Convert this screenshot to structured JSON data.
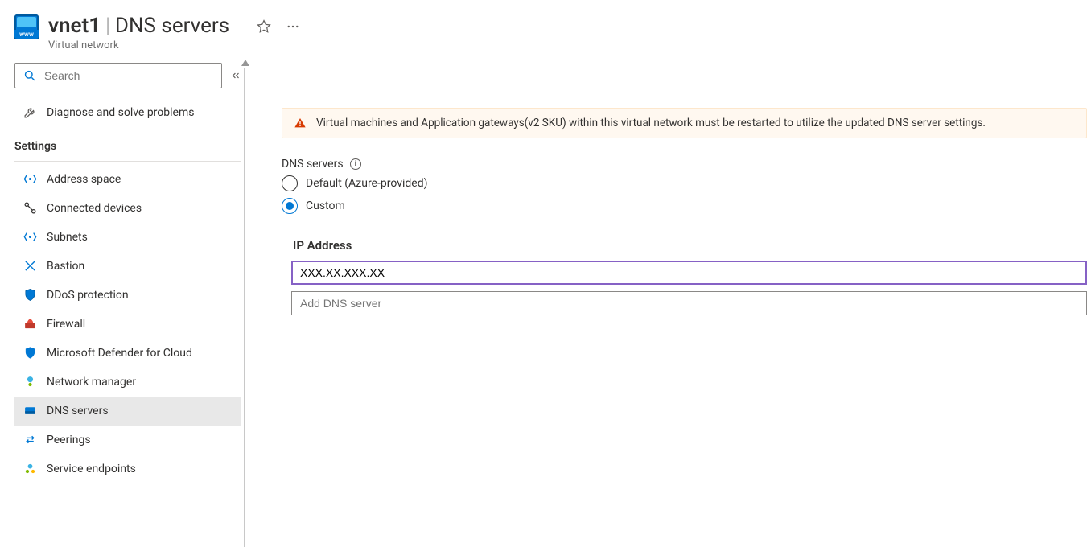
{
  "header": {
    "resource_name": "vnet1",
    "page_title": "DNS servers",
    "resource_type": "Virtual network"
  },
  "sidebar": {
    "search_placeholder": "Search",
    "top_item": {
      "label": "Diagnose and solve problems"
    },
    "section_label": "Settings",
    "items": [
      {
        "label": "Address space",
        "selected": false
      },
      {
        "label": "Connected devices",
        "selected": false
      },
      {
        "label": "Subnets",
        "selected": false
      },
      {
        "label": "Bastion",
        "selected": false
      },
      {
        "label": "DDoS protection",
        "selected": false
      },
      {
        "label": "Firewall",
        "selected": false
      },
      {
        "label": "Microsoft Defender for Cloud",
        "selected": false
      },
      {
        "label": "Network manager",
        "selected": false
      },
      {
        "label": "DNS servers",
        "selected": true
      },
      {
        "label": "Peerings",
        "selected": false
      },
      {
        "label": "Service endpoints",
        "selected": false
      }
    ]
  },
  "main": {
    "banner_text": "Virtual machines and Application gateways(v2 SKU) within this virtual network must be restarted to utilize the updated DNS server settings.",
    "form_label": "DNS servers",
    "radios": {
      "default_label": "Default (Azure-provided)",
      "custom_label": "Custom",
      "selected": "custom"
    },
    "ip_section_header": "IP Address",
    "ip_value": "XXX.XX.XXX.XX",
    "add_placeholder": "Add DNS server"
  }
}
